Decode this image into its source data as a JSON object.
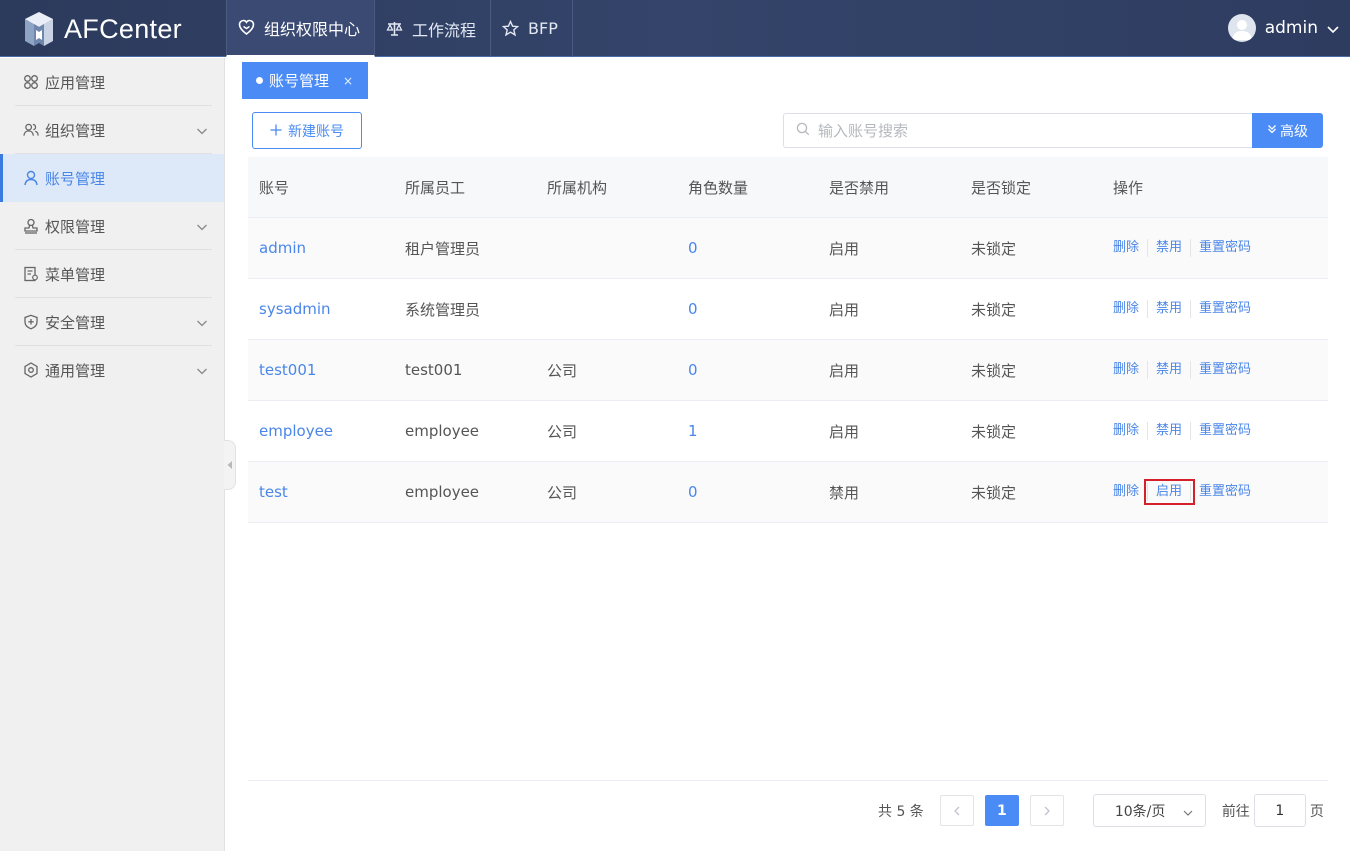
{
  "app": {
    "title": "AFCenter"
  },
  "topnav": [
    {
      "label": "组织权限中心",
      "icon": "heart-shield-icon",
      "active": true
    },
    {
      "label": "工作流程",
      "icon": "scale-icon",
      "active": false
    },
    {
      "label": "BFP",
      "icon": "star-icon",
      "active": false
    }
  ],
  "user": {
    "name": "admin"
  },
  "sidebar": {
    "items": [
      {
        "label": "应用管理",
        "icon": "grid-icon",
        "expandable": false,
        "active": false
      },
      {
        "label": "组织管理",
        "icon": "users-icon",
        "expandable": true,
        "active": false
      },
      {
        "label": "账号管理",
        "icon": "user-icon",
        "expandable": false,
        "active": true
      },
      {
        "label": "权限管理",
        "icon": "stamp-icon",
        "expandable": true,
        "active": false
      },
      {
        "label": "菜单管理",
        "icon": "menu-doc-icon",
        "expandable": false,
        "active": false
      },
      {
        "label": "安全管理",
        "icon": "shield-plus-icon",
        "expandable": true,
        "active": false
      },
      {
        "label": "通用管理",
        "icon": "settings-icon",
        "expandable": true,
        "active": false
      }
    ]
  },
  "tabs": [
    {
      "label": "账号管理",
      "close": "×"
    }
  ],
  "toolbar": {
    "new_label": "新建账号",
    "search_placeholder": "输入账号搜索",
    "advanced_label": "高级"
  },
  "table": {
    "headers": [
      "账号",
      "所属员工",
      "所属机构",
      "角色数量",
      "是否禁用",
      "是否锁定",
      "操作"
    ],
    "rows": [
      {
        "account": "admin",
        "employee": "租户管理员",
        "org": "",
        "roles": "0",
        "disabled": "启用",
        "locked": "未锁定",
        "ops": [
          "删除",
          "禁用",
          "重置密码"
        ]
      },
      {
        "account": "sysadmin",
        "employee": "系统管理员",
        "org": "",
        "roles": "0",
        "disabled": "启用",
        "locked": "未锁定",
        "ops": [
          "删除",
          "禁用",
          "重置密码"
        ]
      },
      {
        "account": "test001",
        "employee": "test001",
        "org": "公司",
        "roles": "0",
        "disabled": "启用",
        "locked": "未锁定",
        "ops": [
          "删除",
          "禁用",
          "重置密码"
        ]
      },
      {
        "account": "employee",
        "employee": "employee",
        "org": "公司",
        "roles": "1",
        "disabled": "启用",
        "locked": "未锁定",
        "ops": [
          "删除",
          "禁用",
          "重置密码"
        ]
      },
      {
        "account": "test",
        "employee": "employee",
        "org": "公司",
        "roles": "0",
        "disabled": "禁用",
        "locked": "未锁定",
        "ops": [
          "删除",
          "启用",
          "重置密码"
        ]
      }
    ]
  },
  "pagination": {
    "total_label": "共 5 条",
    "current_page": "1",
    "page_size_label": "10条/页",
    "goto_label": "前往",
    "goto_value": "1",
    "page_unit": "页"
  },
  "colors": {
    "accent": "#4a8bf5",
    "topbar": "#2e3c60",
    "highlight": "#d3202a"
  }
}
